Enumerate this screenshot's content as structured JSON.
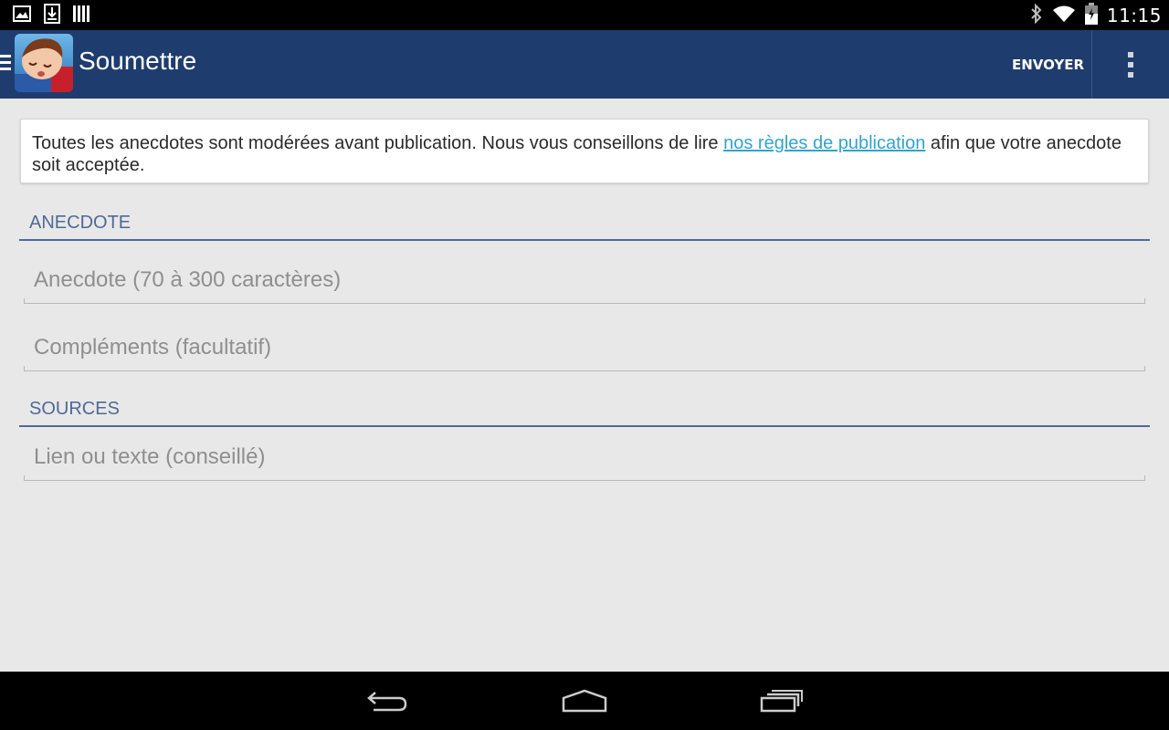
{
  "status_bar": {
    "time": "11:15",
    "icons_left": [
      "gallery-icon",
      "download-icon",
      "barcode-icon"
    ],
    "icons_right": [
      "bluetooth-icon",
      "wifi-icon",
      "battery-icon"
    ]
  },
  "action_bar": {
    "title": "Soumettre",
    "send_label": "ENVOYER",
    "background": "#1f3c6e"
  },
  "notice": {
    "text_before": "Toutes les anecdotes sont modérées avant publication. Nous vous conseillons de lire ",
    "link_text": "nos règles de publication",
    "text_after": " afin que votre anecdote soit acceptée.",
    "link_color": "#33a3c9"
  },
  "sections": {
    "anecdote": {
      "header": "ANECDOTE",
      "anecdote_field": {
        "value": "",
        "placeholder": "Anecdote (70 à 300 caractères)"
      },
      "complements_field": {
        "value": "",
        "placeholder": "Compléments (facultatif)"
      }
    },
    "sources": {
      "header": "SOURCES",
      "link_field": {
        "value": "",
        "placeholder": "Lien ou texte (conseillé)"
      }
    }
  },
  "nav_bar": {
    "buttons": [
      "back-icon",
      "home-icon",
      "recent-apps-icon"
    ]
  },
  "colors": {
    "section_accent": "#4e6a96",
    "content_background": "#e8e8e8"
  }
}
